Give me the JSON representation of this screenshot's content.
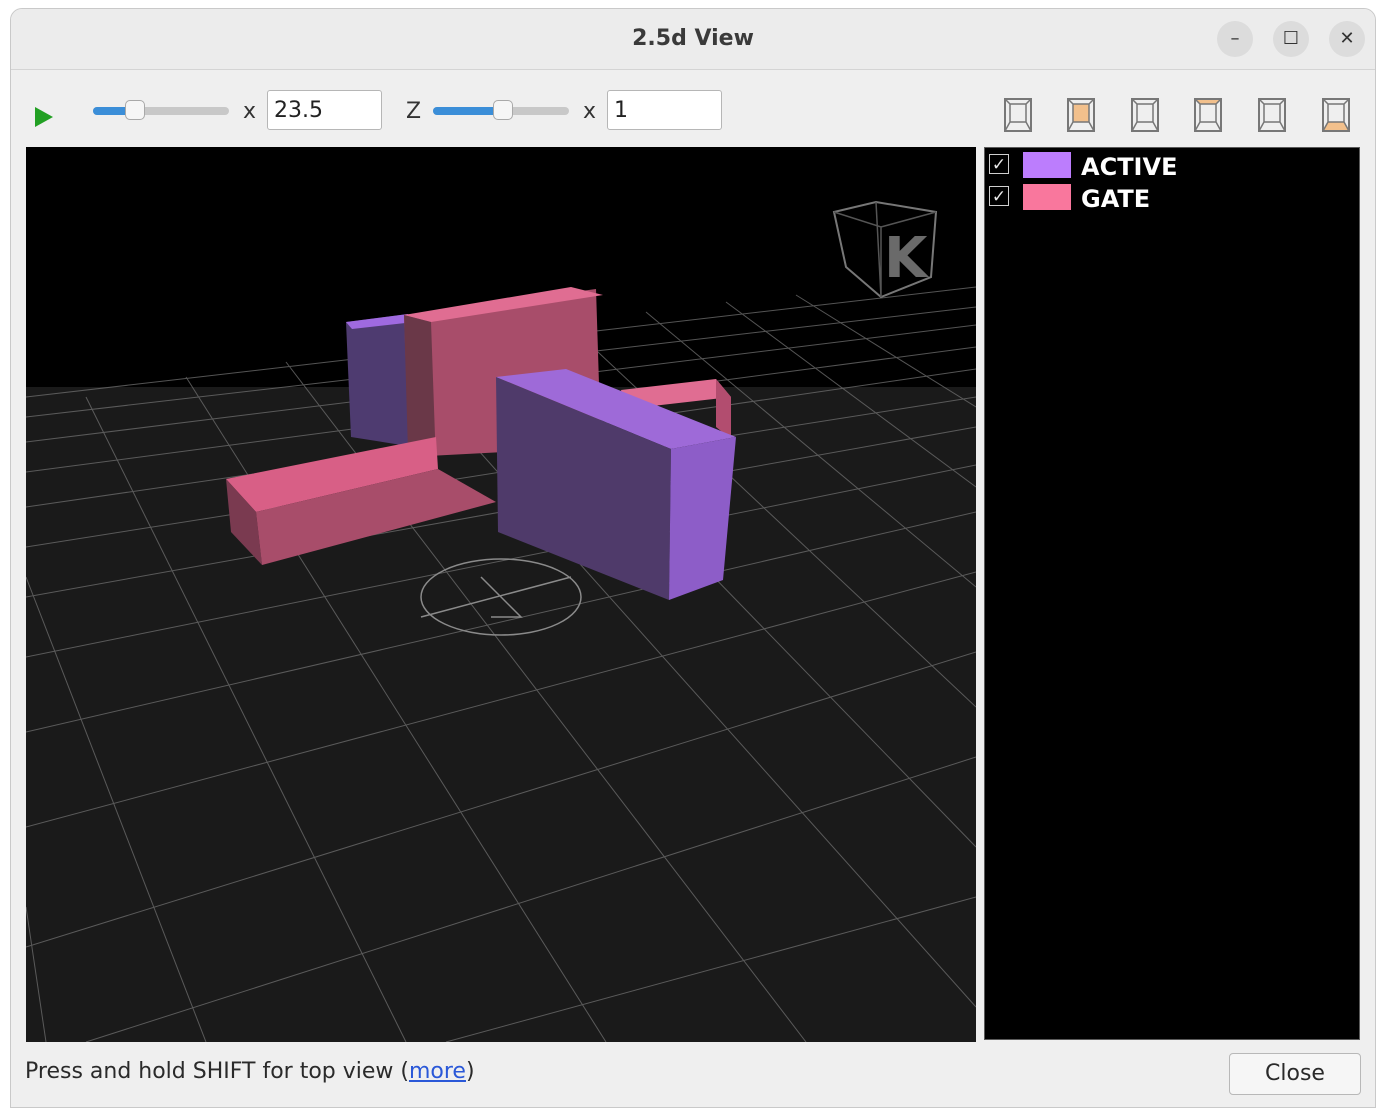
{
  "window": {
    "title": "2.5d View",
    "minimize_glyph": "–",
    "maximize_glyph": "☐",
    "close_glyph": "✕"
  },
  "toolbar": {
    "play_icon": "play-icon",
    "x_scale_label": "x",
    "x_scale_value": "23.5",
    "x_slider_level": 0.28,
    "z_label": "Z",
    "z_scale_label": "x",
    "z_scale_value": "1",
    "z_slider_level": 0.5,
    "view_buttons": [
      "front-view-icon",
      "top-view-icon",
      "back-view-icon",
      "left-view-icon",
      "right-view-icon",
      "bottom-view-icon"
    ]
  },
  "scene": {
    "logo_letter": "K",
    "layers_colors": {
      "active": "#a674e8",
      "gate": "#e8769a"
    }
  },
  "legend": {
    "items": [
      {
        "label": "ACTIVE",
        "color": "#bc7dfd",
        "checked": true
      },
      {
        "label": "GATE",
        "color": "#f9779d",
        "checked": true
      }
    ]
  },
  "footer": {
    "hint_text": "Press and hold SHIFT for top view (",
    "hint_link": "more",
    "hint_end": ")",
    "close_label": "Close"
  }
}
